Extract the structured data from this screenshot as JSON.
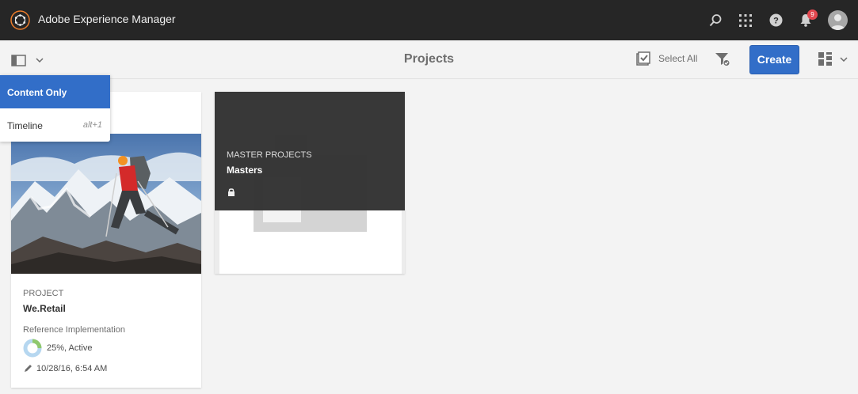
{
  "app": {
    "title": "Adobe Experience Manager",
    "notification_count": "9"
  },
  "header": {
    "page_title": "Projects",
    "select_all_label": "Select All",
    "create_label": "Create"
  },
  "rail_menu": {
    "items": [
      {
        "label": "Content Only",
        "shortcut": "",
        "selected": true
      },
      {
        "label": "Timeline",
        "shortcut": "alt+1",
        "selected": false
      }
    ]
  },
  "cards": [
    {
      "type": "PROJECT",
      "title": "We.Retail",
      "description": "Reference Implementation",
      "progress_percent": 25,
      "progress_label": "25%, Active",
      "modified": "10/28/16, 6:54 AM"
    },
    {
      "type": "MASTER PROJECTS",
      "title": "Masters",
      "locked": true
    }
  ],
  "colors": {
    "topbar": "#262626",
    "accent": "#326ec8",
    "background": "#f3f3f3"
  },
  "icons": [
    "aem-logo-icon",
    "search-icon",
    "apps-grid-icon",
    "help-icon",
    "bell-icon",
    "avatar",
    "rail-toggle-icon",
    "chevron-down-icon",
    "select-all-icon",
    "filter-icon",
    "card-view-icon",
    "lock-icon",
    "pencil-icon"
  ]
}
